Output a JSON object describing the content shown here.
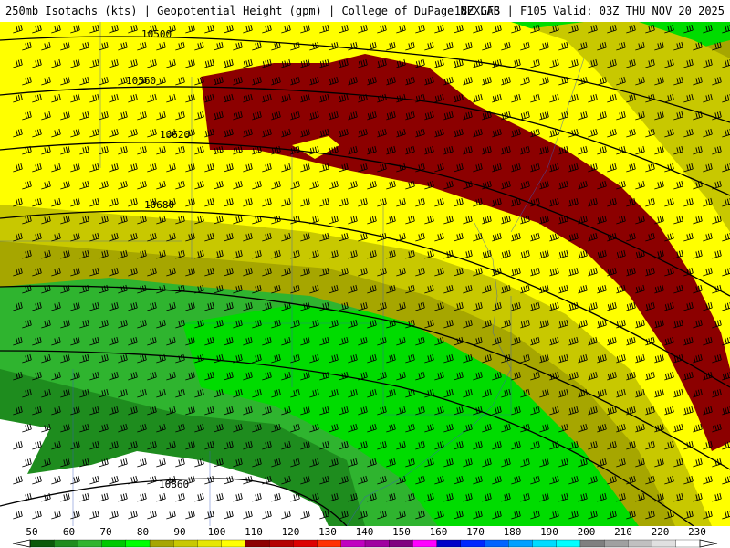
{
  "header": {
    "left": "250mb Isotachs (kts) | Geopotential Height (gpm) | College of DuPage NEXLAB",
    "right": "18Z GFS | F105 Valid: 03Z THU NOV 20 2025"
  },
  "map": {
    "contour_labels": [
      "10500",
      "10560",
      "10620",
      "10680",
      "10860"
    ],
    "speed_bands": [
      {
        "label": "50-60 kt",
        "color": "#1e8c1e"
      },
      {
        "label": "60-70 kt",
        "color": "#2fb42f"
      },
      {
        "label": "70-80 kt",
        "color": "#00dc00"
      },
      {
        "label": "80-90 kt",
        "color": "#a6a600"
      },
      {
        "label": "90-100 kt",
        "color": "#c8c800"
      },
      {
        "label": "100-110 kt",
        "color": "#ffff00"
      },
      {
        "label": "110+ kt",
        "color": "#8c0000"
      }
    ],
    "wind_barb_color": "#000000",
    "boundary_color": "#3b5bbf"
  },
  "colorbar": {
    "ticks": [
      "50",
      "60",
      "70",
      "80",
      "90",
      "100",
      "110",
      "120",
      "130",
      "140",
      "150",
      "160",
      "170",
      "180",
      "190",
      "200",
      "210",
      "220",
      "230"
    ],
    "colors": [
      "#0a5a0a",
      "#1e8c1e",
      "#2fb42f",
      "#00c800",
      "#00ff00",
      "#a6a600",
      "#c8c800",
      "#e6e600",
      "#ffff00",
      "#8c0000",
      "#b40000",
      "#dc0000",
      "#ff3000",
      "#c000c0",
      "#a000a0",
      "#800080",
      "#ff00ff",
      "#0000c8",
      "#0028ff",
      "#0064ff",
      "#00a0ff",
      "#00dcff",
      "#00ffff",
      "#7f7f7f",
      "#a0a0a0",
      "#c0c0c0",
      "#e0e0e0",
      "#ffffff"
    ]
  }
}
